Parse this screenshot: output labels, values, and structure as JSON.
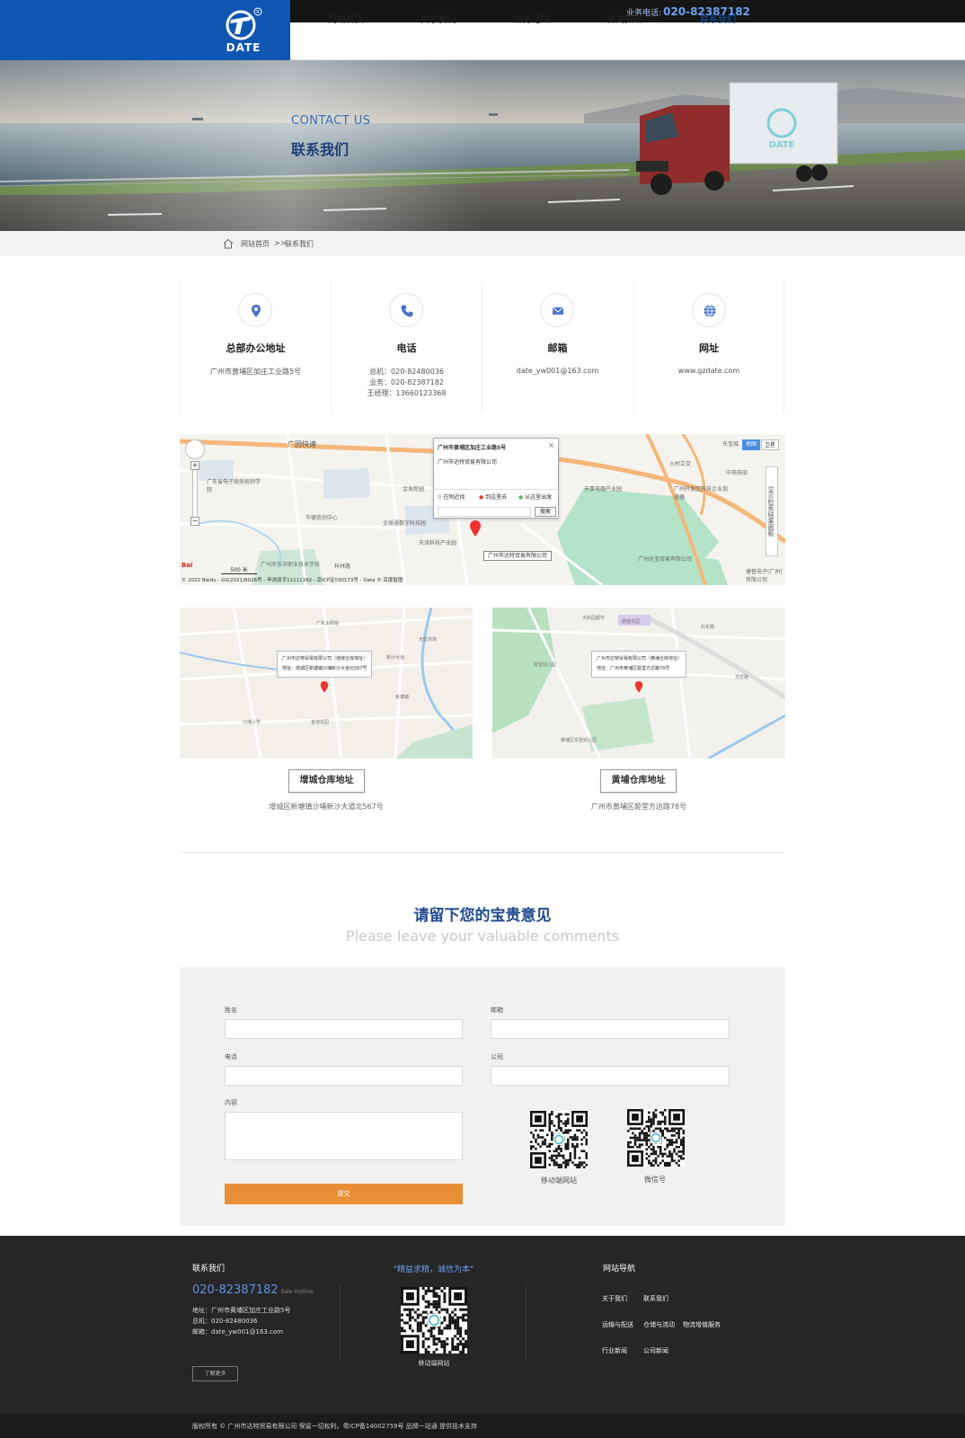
{
  "header": {
    "logo_text": "DATE",
    "hotline_label": "业务电话:",
    "hotline_number": "020-82387182",
    "nav": [
      "网站首页",
      "关于我们",
      "业务范围",
      "新闻资讯",
      "联系我们"
    ]
  },
  "banner": {
    "title_en": "CONTACT US",
    "title_cn": "联系我们",
    "truck_logo": "DATE"
  },
  "breadcrumb": {
    "home": "网站首页",
    "sep": ">>",
    "current": "联系我们"
  },
  "contact_cards": [
    {
      "icon": "location-icon",
      "title": "总部办公地址",
      "lines": [
        "广州市黄埔区加庄工业路5号"
      ]
    },
    {
      "icon": "phone-icon",
      "title": "电话",
      "lines": [
        "总机：020-82480036",
        "业务：020-82387182",
        "王经理：13660123368"
      ]
    },
    {
      "icon": "mail-icon",
      "title": "邮箱",
      "lines": [
        "date_yw001@163.com"
      ]
    },
    {
      "icon": "globe-icon",
      "title": "网址",
      "lines": [
        "www.gzdate.com"
      ]
    }
  ],
  "big_map": {
    "popup_title": "广州市黄埔区加庄工业路5号",
    "popup_company": "广州市达特贸易有限公司",
    "popup_actions": [
      "在附近找",
      "到这里去",
      "从这里出发"
    ],
    "search_button": "搜索",
    "marker_label": "广州市达特贸易有限公司",
    "map_type_buttons": [
      "地图",
      "卫星"
    ],
    "side_panel": "显示检索结果面板",
    "scale": "500 米",
    "copyright": "© 2022 Baidu - GS(2021)6026号 - 甲测资字11111342 - 京ICP证030173号 - Data © 百度智图",
    "labels": [
      "广园快速",
      "广东省电子商务技师学院",
      "华德信创中心",
      "金发新园",
      "全球通数字科技园",
      "天泽科技产业园",
      "广州市东华职业技术学校",
      "科林路",
      "天事电器产业园",
      "广州开发区科技企业加速器",
      "火村立交",
      "中央府邸",
      "广州达宝贸易有限公司",
      "捷普电子(广州)有限公司",
      "东宝城"
    ]
  },
  "warehouses": [
    {
      "popup_line1": "广州市达特贸易有限公司（增城仓库地址）",
      "popup_line2": "地址：增城区新塘镇沙埔新沙大道北567号",
      "button": "增城仓库地址",
      "address": "增城区新塘镇沙埔新沙大道北567号",
      "labels": [
        "广东太阳能",
        "新沙大道",
        "沙埔小学",
        "天虹商场",
        "新塘镇",
        "金地花园"
      ]
    },
    {
      "popup_line1": "广州市达特贸易有限公司（黄埔仓库地址）",
      "popup_line2": "地址：广州市黄埔区姬堂方达路78号",
      "button": "黄埔仓库地址",
      "address": "广州市黄埔区姬堂方达路78号",
      "labels": [
        "大科园超市",
        "德盛花园",
        "石化路",
        "姬堂幼儿园",
        "方达路",
        "黄埔区实验幼儿园"
      ]
    }
  ],
  "comments": {
    "title_cn": "请留下您的宝贵意见",
    "title_en": "Please leave your valuable comments",
    "fields": {
      "name": "姓名",
      "email": "邮箱",
      "phone": "电话",
      "company": "公司",
      "content": "内容"
    },
    "submit": "提交",
    "qr_captions": [
      "移动端网站",
      "微信号"
    ]
  },
  "footer": {
    "contact_title": "联系我们",
    "phone": "020-82387182",
    "phone_tag": "Sale Hotline",
    "address": "地址：广州市黄埔区加庄工业路5号",
    "switchboard": "总机：020-82480036",
    "email": "邮箱：date_yw001@163.com",
    "more": "了解更多",
    "slogan": "\"精益求精，诚信为本\"",
    "qr_caption": "移动端网站",
    "nav_title": "网站导航",
    "nav_links": [
      [
        "关于我们",
        "联系我们"
      ],
      [
        "运输与配送",
        "仓储与流动",
        "物流增值服务"
      ],
      [
        "行业新闻",
        "公司新闻"
      ]
    ],
    "copyright": "版权所有 © 广州市达特贸易有限公司  保留一切权利。粤ICP备14002759号  品牌一站通 提供技术支持"
  },
  "colors": {
    "brand_blue": "#0f56b3",
    "title_blue": "#1e4a8e",
    "submit_orange": "#e98f36",
    "footer_bg": "#262626"
  }
}
